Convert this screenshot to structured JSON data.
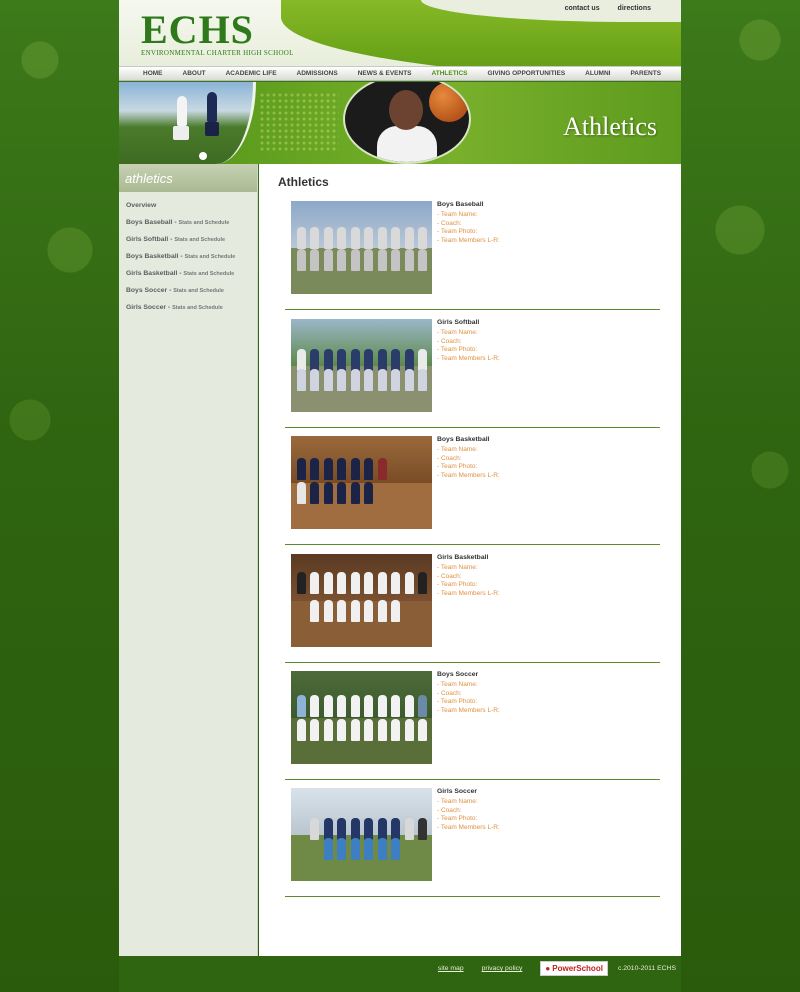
{
  "header": {
    "logo_text": "ECHS",
    "logo_subtitle": "ENVIRONMENTAL CHARTER HIGH SCHOOL",
    "top_links": [
      "contact us",
      "directions"
    ]
  },
  "nav": {
    "items": [
      "HOME",
      "ABOUT",
      "ACADEMIC LIFE",
      "ADMISSIONS",
      "NEWS & EVENTS",
      "ATHLETICS",
      "GIVING OPPORTUNITIES",
      "ALUMNI",
      "PARENTS"
    ],
    "active": "ATHLETICS"
  },
  "banner": {
    "title": "Athletics"
  },
  "sidebar": {
    "heading": "athletics",
    "items": [
      {
        "label": "Overview",
        "sub": ""
      },
      {
        "label": "Boys Baseball - ",
        "sub": "Stats and Schedule"
      },
      {
        "label": "Girls Softball - ",
        "sub": "Stats and Schedule"
      },
      {
        "label": "Boys Basketball - ",
        "sub": "Stats and Schedule"
      },
      {
        "label": "Girls Basketball - ",
        "sub": "Stats and Schedule"
      },
      {
        "label": "Boys Soccer - ",
        "sub": "Stats and Schedule"
      },
      {
        "label": "Girls Soccer - ",
        "sub": "Stats and Schedule"
      }
    ]
  },
  "main": {
    "title": "Athletics",
    "teams": [
      {
        "name": "Boys Baseball",
        "lines": [
          "- Team Name:",
          "- Coach:",
          "- Team Photo:",
          "- Team Members L-R:"
        ]
      },
      {
        "name": "Girls Softball",
        "lines": [
          "- Team Name:",
          "- Coach:",
          "- Team Photo:",
          "- Team Members L-R:"
        ]
      },
      {
        "name": "Boys Basketball",
        "lines": [
          "- Team Name:",
          "- Coach:",
          "- Team Photo:",
          "- Team Members L-R:"
        ]
      },
      {
        "name": "Girls Basketball",
        "lines": [
          "- Team Name:",
          "- Coach:",
          "- Team Photo:",
          "- Team Members L-R:"
        ]
      },
      {
        "name": "Boys Soccer",
        "lines": [
          "- Team Name:",
          "- Coach:",
          "- Team Photo:",
          "- Team Members L-R:"
        ]
      },
      {
        "name": "Girls Soccer",
        "lines": [
          "- Team Name:",
          "- Coach:",
          "- Team Photo:",
          "- Team Members L-R:"
        ]
      }
    ]
  },
  "footer": {
    "site_map": "site map",
    "privacy_policy": "privacy policy",
    "powerschool": "PowerSchool",
    "copyright": "c.2010-2011 ECHS"
  },
  "colors": {
    "brand_green": "#4e8d12",
    "background_green": "#2f6410",
    "detail_orange": "#e09040"
  }
}
